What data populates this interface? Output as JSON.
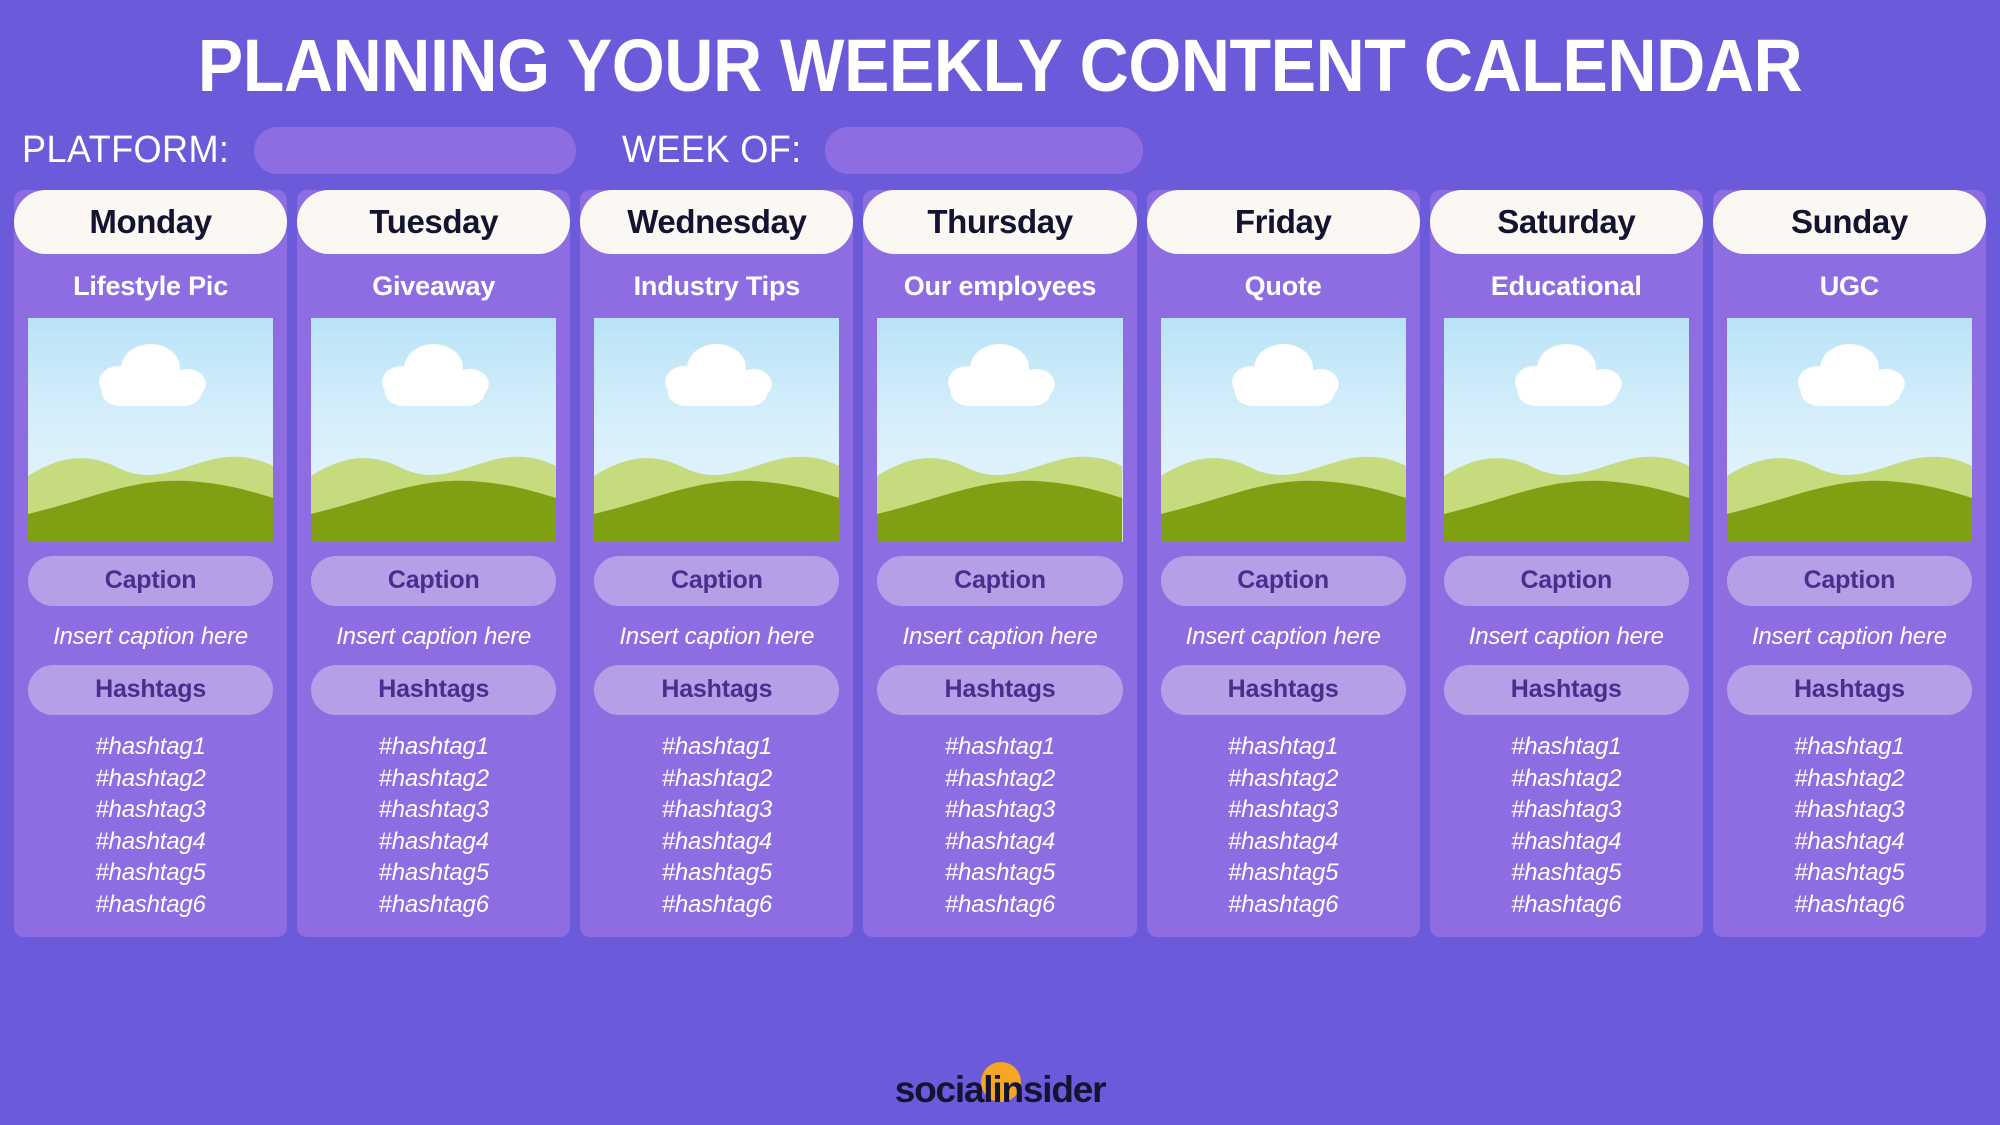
{
  "header": {
    "title": "PLANNING YOUR WEEKLY CONTENT CALENDAR",
    "platform_label": "PLATFORM:",
    "platform_value": "",
    "platform_placeholder": "",
    "week_label": "WEEK OF:",
    "week_value": "",
    "week_placeholder": ""
  },
  "labels": {
    "caption_pill": "Caption",
    "caption_placeholder": "Insert caption here",
    "hashtags_pill": "Hashtags"
  },
  "hashtags": [
    "#hashtag1",
    "#hashtag2",
    "#hashtag3",
    "#hashtag4",
    "#hashtag5",
    "#hashtag6"
  ],
  "days": [
    {
      "name": "Monday",
      "content_type": "Lifestyle Pic",
      "caption": "Insert caption here",
      "image": "landscape-placeholder-image"
    },
    {
      "name": "Tuesday",
      "content_type": "Giveaway",
      "caption": "Insert caption here",
      "image": "landscape-placeholder-image"
    },
    {
      "name": "Wednesday",
      "content_type": "Industry Tips",
      "caption": "Insert caption here",
      "image": "landscape-placeholder-image"
    },
    {
      "name": "Thursday",
      "content_type": "Our employees",
      "caption": "Insert caption here",
      "image": "landscape-placeholder-image"
    },
    {
      "name": "Friday",
      "content_type": "Quote",
      "caption": "Insert caption here",
      "image": "landscape-placeholder-image"
    },
    {
      "name": "Saturday",
      "content_type": "Educational",
      "caption": "Insert caption here",
      "image": "landscape-placeholder-image"
    },
    {
      "name": "Sunday",
      "content_type": "UGC",
      "caption": "Insert caption here",
      "image": "landscape-placeholder-image"
    }
  ],
  "footer": {
    "brand": "socialinsider",
    "brand_mark": "orange-circle-logo-mark"
  },
  "colors": {
    "page_background": "#6B5BDB",
    "card_background": "#8E6DE2",
    "day_pill_background": "#FBF8F3",
    "day_pill_text": "#141330",
    "field_pill_background": "#B5A0E8",
    "field_pill_text": "#4C2D8E",
    "text_on_card": "#FFFFFF",
    "brand_accent": "#F5A623",
    "brand_text": "#141330",
    "image_sky_top": "#B9E3F7",
    "image_sky_bottom": "#E9F6FC",
    "image_hill_back": "#C5DB7E",
    "image_hill_front": "#7FA012",
    "image_cloud": "#FFFFFF"
  }
}
